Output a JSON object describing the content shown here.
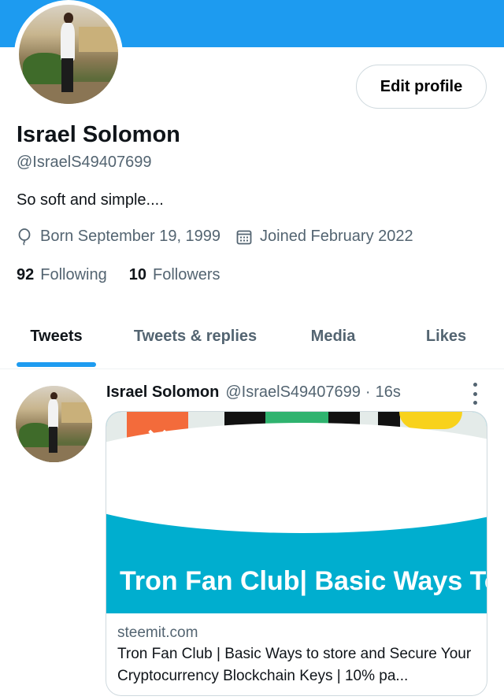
{
  "profile": {
    "edit_button": "Edit profile",
    "name": "Israel Solomon",
    "handle": "@IsraelS49407699",
    "bio": "So soft and simple....",
    "born": "Born September 19, 1999",
    "joined": "Joined February 2022",
    "following_count": "92",
    "following_label": "Following",
    "followers_count": "10",
    "followers_label": "Followers"
  },
  "tabs": [
    {
      "label": "Tweets",
      "active": true
    },
    {
      "label": "Tweets & replies",
      "active": false
    },
    {
      "label": "Media",
      "active": false
    },
    {
      "label": "Likes",
      "active": false
    }
  ],
  "tweet": {
    "author": "Israel Solomon",
    "handle": "@IsraelS49407699",
    "separator": "·",
    "time": "16s",
    "card": {
      "image_title": "Tron Fan Club| Basic Ways To Secure and Store Your",
      "domain": "steemit.com",
      "description": "Tron Fan Club | Basic Ways to store and Secure Your Cryptocurrency Blockchain Keys | 10% pa..."
    }
  },
  "colors": {
    "accent": "#1d9bf0",
    "card_image_bg": "#00aecf",
    "secondary_text": "#536471"
  },
  "icons": {
    "born": "balloon-icon",
    "joined": "calendar-icon",
    "more": "more-vertical-icon"
  }
}
